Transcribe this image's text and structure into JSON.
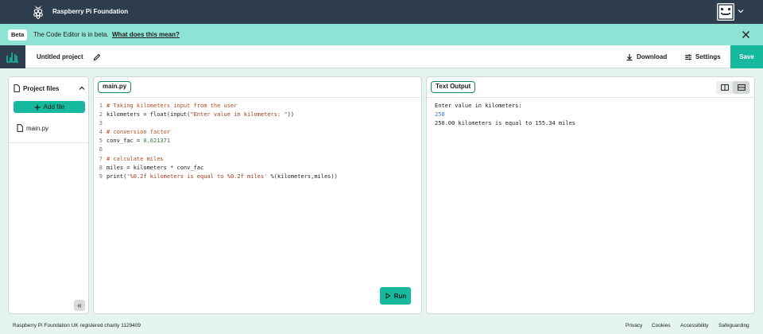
{
  "topbar": {
    "brand": "Raspberry Pi Foundation",
    "logo_icon": "raspberry-icon",
    "avatar_icon": "robot-face-icon"
  },
  "beta_banner": {
    "badge": "Beta",
    "text": "The Code Editor is in beta.",
    "link": "What does this mean?"
  },
  "project": {
    "name": "Untitled project",
    "download_label": "Download",
    "settings_label": "Settings",
    "save_label": "Save"
  },
  "sidebar": {
    "title": "Project files",
    "add_file_label": "Add file",
    "files": [
      {
        "name": "main.py"
      }
    ],
    "collapse_label": "«"
  },
  "editor": {
    "tab": "main.py",
    "lines": [
      {
        "n": "1",
        "parts": [
          {
            "t": "# Taking kilometers input from the user",
            "c": "c-com"
          }
        ]
      },
      {
        "n": "2",
        "parts": [
          {
            "t": "kilometers = float(input(",
            "c": ""
          },
          {
            "t": "\"Enter value in kilometers: \"",
            "c": "c-str"
          },
          {
            "t": "))",
            "c": ""
          }
        ]
      },
      {
        "n": "3",
        "parts": []
      },
      {
        "n": "4",
        "parts": [
          {
            "t": "# conversion factor",
            "c": "c-com"
          }
        ]
      },
      {
        "n": "5",
        "parts": [
          {
            "t": "conv_fac = ",
            "c": ""
          },
          {
            "t": "0.621371",
            "c": "c-num"
          }
        ]
      },
      {
        "n": "6",
        "parts": []
      },
      {
        "n": "7",
        "parts": [
          {
            "t": "# calculate miles",
            "c": "c-com"
          }
        ]
      },
      {
        "n": "8",
        "parts": [
          {
            "t": "miles = kilometers * conv_fac",
            "c": ""
          }
        ]
      },
      {
        "n": "9",
        "parts": [
          {
            "t": "print(",
            "c": ""
          },
          {
            "t": "'%0.2f kilometers is equal to %0.2f miles'",
            "c": "c-str"
          },
          {
            "t": " %(kilometers,miles))",
            "c": ""
          }
        ]
      }
    ],
    "run_label": "Run"
  },
  "output": {
    "tab": "Text Output",
    "console": {
      "prompt": "Enter value in kilometers:",
      "input": "250",
      "result": "250.00 kilometers is equal to 155.34 miles"
    }
  },
  "footer": {
    "charity": "Raspberry Pi Foundation UK registered charity 1129409",
    "links": [
      "Privacy",
      "Cookies",
      "Accessibility",
      "Safeguarding"
    ]
  },
  "colors": {
    "accent": "#16b99e",
    "topbar": "#2e3d4e",
    "banner": "#8fe3d4",
    "background": "#e6f4f1"
  }
}
